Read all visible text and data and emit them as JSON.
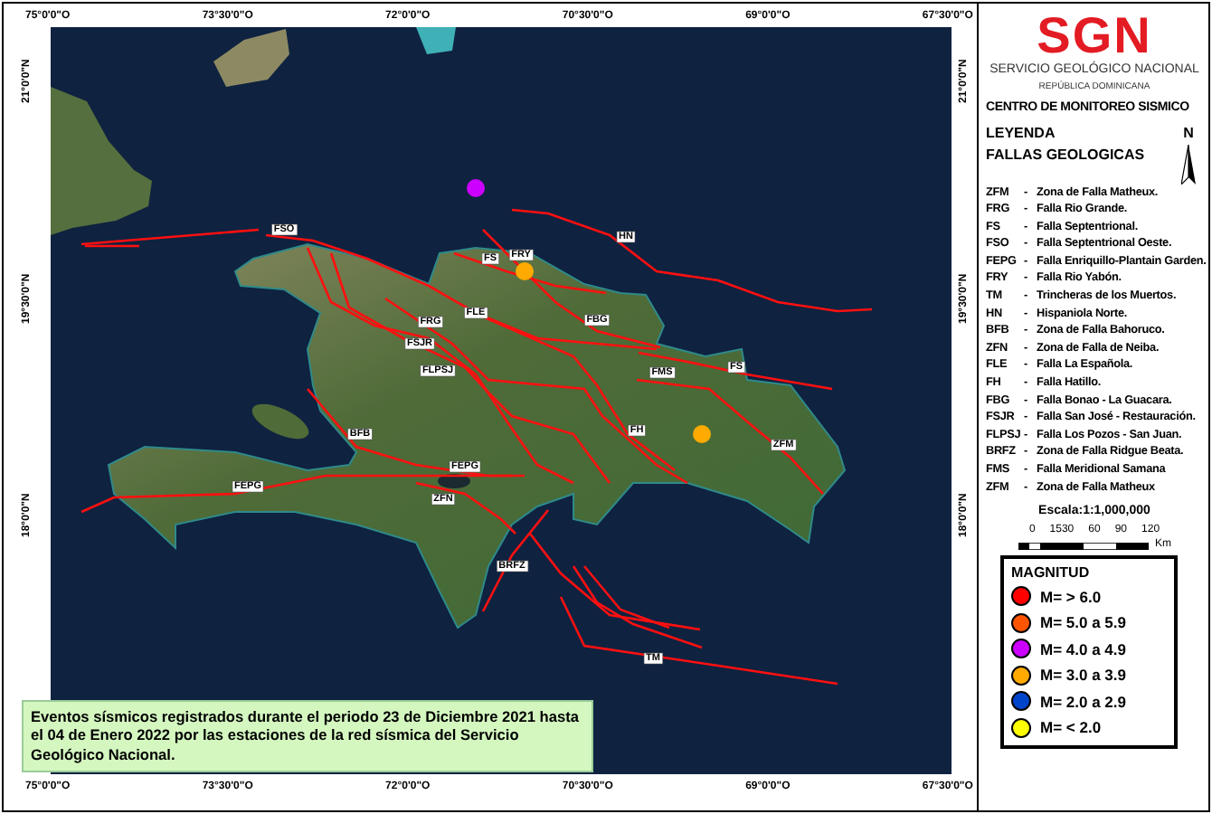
{
  "map": {
    "top_axis_labels": [
      "75°0'0\"O",
      "73°30'0\"O",
      "72°0'0\"O",
      "70°30'0\"O",
      "69°0'0\"O",
      "67°30'0\"O"
    ],
    "bottom_axis_labels": [
      "75°0'0\"O",
      "73°30'0\"O",
      "72°0'0\"O",
      "70°30'0\"O",
      "69°0'0\"O",
      "67°30'0\"O"
    ],
    "left_axis_labels": [
      "21°0'0\"N",
      "19°30'0\"N",
      "18°0'0\"N"
    ],
    "right_axis_labels": [
      "21°0'0\"N",
      "19°30'0\"N",
      "18°0'0\"N"
    ],
    "fault_labels": [
      {
        "label": "FSO"
      },
      {
        "label": "HN"
      },
      {
        "label": "FRY"
      },
      {
        "label": "FS"
      },
      {
        "label": "FLE"
      },
      {
        "label": "FRG"
      },
      {
        "label": "FSJR"
      },
      {
        "label": "FLPSJ"
      },
      {
        "label": "FBG"
      },
      {
        "label": "FH"
      },
      {
        "label": "FMS"
      },
      {
        "label": "FS"
      },
      {
        "label": "ZFM"
      },
      {
        "label": "BFB"
      },
      {
        "label": "FEPG"
      },
      {
        "label": "ZFN"
      },
      {
        "label": "FEPG"
      },
      {
        "label": "BRFZ"
      },
      {
        "label": "TM"
      }
    ],
    "events": [
      {
        "color": "#cc00ff"
      },
      {
        "color": "#ffaa00"
      },
      {
        "color": "#ffaa00"
      }
    ],
    "caption": "Eventos sísmicos registrados durante el periodo 23 de Diciembre 2021 hasta el 04 de Enero 2022 por las estaciones de la red sísmica del Servicio Geológico Nacional."
  },
  "legend": {
    "logo": "SGN",
    "organization": "SERVICIO GEOLÓGICO NACIONAL",
    "country": "REPÚBLICA DOMINICANA",
    "center": "CENTRO DE MONITOREO SISMICO",
    "title": "LEYENDA",
    "north": "N",
    "faults_title": "FALLAS GEOLOGICAS",
    "faults": [
      {
        "code": "ZFM",
        "separator": "-",
        "name": "Zona de Falla Matheux."
      },
      {
        "code": "FRG",
        "separator": "-",
        "name": "Falla Rio Grande."
      },
      {
        "code": "FS",
        "separator": "-",
        "name": "Falla Septentrional."
      },
      {
        "code": "FSO",
        "separator": "-",
        "name": "Falla Septentrional Oeste."
      },
      {
        "code": "FEPG",
        "separator": "-",
        "name": "Falla Enriquillo-Plantain Garden."
      },
      {
        "code": "FRY",
        "separator": "-",
        "name": "Falla Rio Yabón."
      },
      {
        "code": "TM",
        "separator": "-",
        "name": "Trincheras de los Muertos."
      },
      {
        "code": "HN",
        "separator": "-",
        "name": "Hispaniola Norte."
      },
      {
        "code": "BFB",
        "separator": "-",
        "name": "Zona de Falla Bahoruco."
      },
      {
        "code": "ZFN",
        "separator": "-",
        "name": "Zona de Falla de Neiba."
      },
      {
        "code": "FLE",
        "separator": "-",
        "name": "Falla La Española."
      },
      {
        "code": "FH",
        "separator": "-",
        "name": "Falla Hatillo."
      },
      {
        "code": "FBG",
        "separator": "-",
        "name": "Falla Bonao - La Guacara."
      },
      {
        "code": "FSJR",
        "separator": "-",
        "name": "Falla San José - Restauración."
      },
      {
        "code": "FLPSJ",
        "separator": "-",
        "name": "Falla Los Pozos - San Juan."
      },
      {
        "code": "BRFZ",
        "separator": "-",
        "name": "Zona de Falla Ridgue Beata."
      },
      {
        "code": "FMS",
        "separator": "-",
        "name": "Falla Meridional Samana"
      },
      {
        "code": "ZFM",
        "separator": "-",
        "name": "Zona de Falla Matheux"
      }
    ],
    "scale_label": "Escala:1:1,000,000",
    "scale_ticks": [
      "0",
      "1530",
      "60",
      "90",
      "120"
    ],
    "scale_unit": "Km",
    "magnitude": {
      "title": "MAGNITUD",
      "items": [
        {
          "label": "M= > 6.0",
          "color": "#ff0000"
        },
        {
          "label": "M= 5.0 a 5.9",
          "color": "#ff5500"
        },
        {
          "label": "M= 4.0 a 4.9",
          "color": "#cc00ff"
        },
        {
          "label": "M= 3.0 a 3.9",
          "color": "#ffaa00"
        },
        {
          "label": "M= 2.0 a 2.9",
          "color": "#0044cc"
        },
        {
          "label": "M= < 2.0",
          "color": "#ffff00"
        }
      ]
    }
  }
}
